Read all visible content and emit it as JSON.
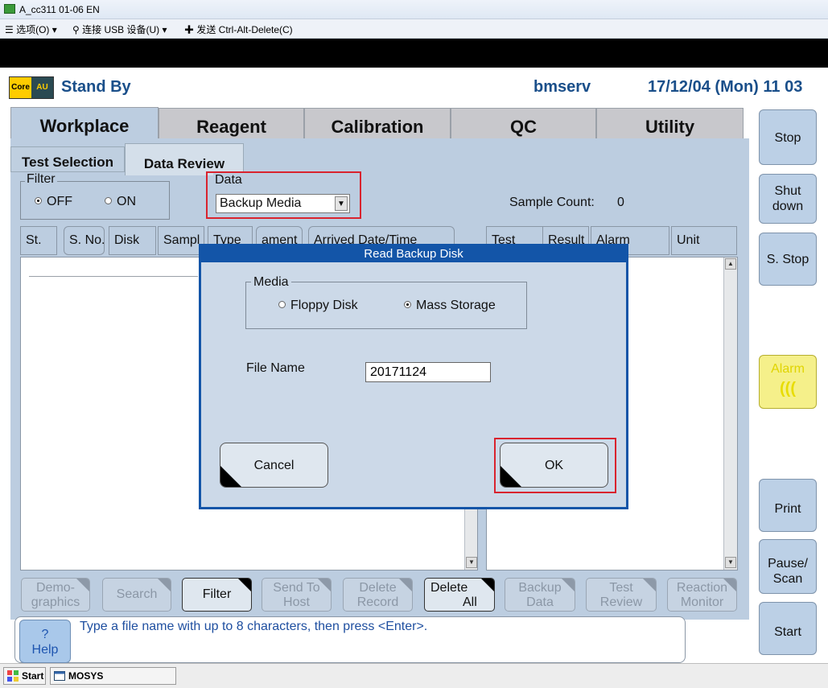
{
  "window": {
    "title": "A_cc311 01-06 EN"
  },
  "menubar": {
    "options": "选项(O)",
    "usb": "连接 USB 设备(U)",
    "send_cad": "发送 Ctrl-Alt-Delete(C)"
  },
  "header": {
    "logo_left": "Core",
    "logo_right": "AU",
    "status": "Stand By",
    "user": "bmserv",
    "datetime": "17/12/04 (Mon) 11 03"
  },
  "tabs": [
    "Workplace",
    "Reagent",
    "Calibration",
    "QC",
    "Utility"
  ],
  "subtabs": [
    "Test Selection",
    "Data Review"
  ],
  "filter": {
    "label": "Filter",
    "off": "OFF",
    "on": "ON",
    "selected": "OFF"
  },
  "data_group": {
    "label": "Data",
    "selected": "Backup Media"
  },
  "sample_count": {
    "label": "Sample Count:",
    "value": "0"
  },
  "left_columns": [
    "St.",
    "S. No.",
    "Disk",
    "Sampl",
    "Type",
    "ament",
    "Arrived Date/Time"
  ],
  "right_columns": [
    "Test",
    "Result",
    "Alarm",
    "Unit"
  ],
  "bottom_buttons": [
    {
      "line1": "Demo-",
      "line2": "graphics"
    },
    {
      "line1": "Search",
      "line2": ""
    },
    {
      "line1": "Filter",
      "line2": ""
    },
    {
      "line1": "Send To",
      "line2": "Host"
    },
    {
      "line1": "Delete",
      "line2": "Record"
    },
    {
      "line1": "Delete",
      "line2": "All"
    },
    {
      "line1": "Backup",
      "line2": "Data"
    },
    {
      "line1": "Test",
      "line2": "Review"
    },
    {
      "line1": "Reaction",
      "line2": "Monitor"
    }
  ],
  "right_buttons": {
    "stop": "Stop",
    "shutdown_1": "Shut",
    "shutdown_2": "down",
    "sstop": "S. Stop",
    "alarm": "Alarm",
    "alarm_glyph": "((( ",
    "print": "Print",
    "pause_1": "Pause/",
    "pause_2": "Scan",
    "start": "Start"
  },
  "dialog": {
    "title": "Read Backup Disk",
    "media_label": "Media",
    "floppy": "Floppy Disk",
    "mass": "Mass Storage",
    "selected_media": "Mass Storage",
    "file_name_label": "File Name",
    "file_name_value": "20171124",
    "cancel": "Cancel",
    "ok": "OK"
  },
  "help": {
    "symbol": "?",
    "label": "Help"
  },
  "message": "Type a file name with up to 8 characters, then press <Enter>.",
  "taskbar": {
    "start": "Start",
    "app": "MOSYS"
  },
  "colors": {
    "accent": "#1355a8",
    "highlight": "#d9232e",
    "panel": "#bccde0",
    "alarm": "#f5f08a"
  }
}
